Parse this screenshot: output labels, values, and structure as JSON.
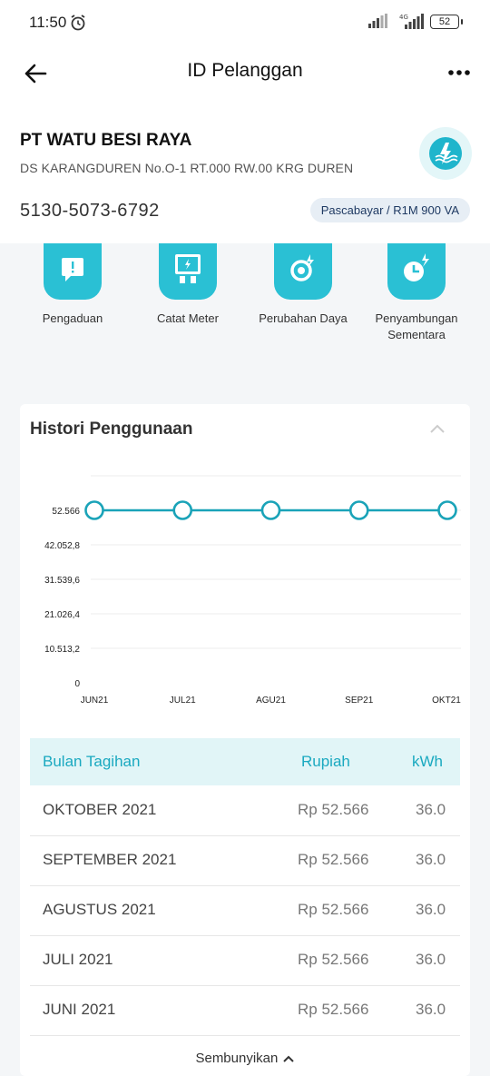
{
  "status_bar": {
    "time": "11:50",
    "network": "4G",
    "battery": "52"
  },
  "app_bar": {
    "title": "ID Pelanggan"
  },
  "customer": {
    "name": "PT WATU BESI RAYA",
    "address": "DS KARANGDUREN No.O-1 RT.000 RW.00 KRG DUREN",
    "id_number": "5130-5073-6792",
    "badge": "Pascabayar / R1M 900 VA"
  },
  "menu": [
    {
      "label": "Pengaduan",
      "icon": "complaint-icon"
    },
    {
      "label": "Catat Meter",
      "icon": "meter-icon"
    },
    {
      "label": "Perubahan Daya",
      "icon": "power-change-icon"
    },
    {
      "label": "Penyambungan Sementara",
      "icon": "temporary-connection-icon"
    }
  ],
  "history": {
    "title": "Histori Penggunaan",
    "toggle_label": "Sembunyikan",
    "table": {
      "headers": {
        "month": "Bulan Tagihan",
        "rupiah": "Rupiah",
        "kwh": "kWh"
      },
      "rows": [
        {
          "month": "OKTOBER 2021",
          "rupiah": "Rp 52.566",
          "kwh": "36.0"
        },
        {
          "month": "SEPTEMBER 2021",
          "rupiah": "Rp 52.566",
          "kwh": "36.0"
        },
        {
          "month": "AGUSTUS 2021",
          "rupiah": "Rp 52.566",
          "kwh": "36.0"
        },
        {
          "month": "JULI 2021",
          "rupiah": "Rp 52.566",
          "kwh": "36.0"
        },
        {
          "month": "JUNI 2021",
          "rupiah": "Rp 52.566",
          "kwh": "36.0"
        }
      ]
    }
  },
  "chart_data": {
    "type": "line",
    "categories": [
      "JUN21",
      "JUL21",
      "AGU21",
      "SEP21",
      "OKT21"
    ],
    "values": [
      52566,
      52566,
      52566,
      52566,
      52566
    ],
    "y_ticks": [
      "0",
      "10.513,2",
      "21.026,4",
      "31.539,6",
      "42.052,8",
      "52.566"
    ],
    "ylim": [
      0,
      52566
    ],
    "grid": true,
    "color": "#1aa3b8"
  },
  "colors": {
    "accent": "#2ac0d4",
    "line": "#1aa3b8",
    "badge_bg": "#e7eef5"
  }
}
